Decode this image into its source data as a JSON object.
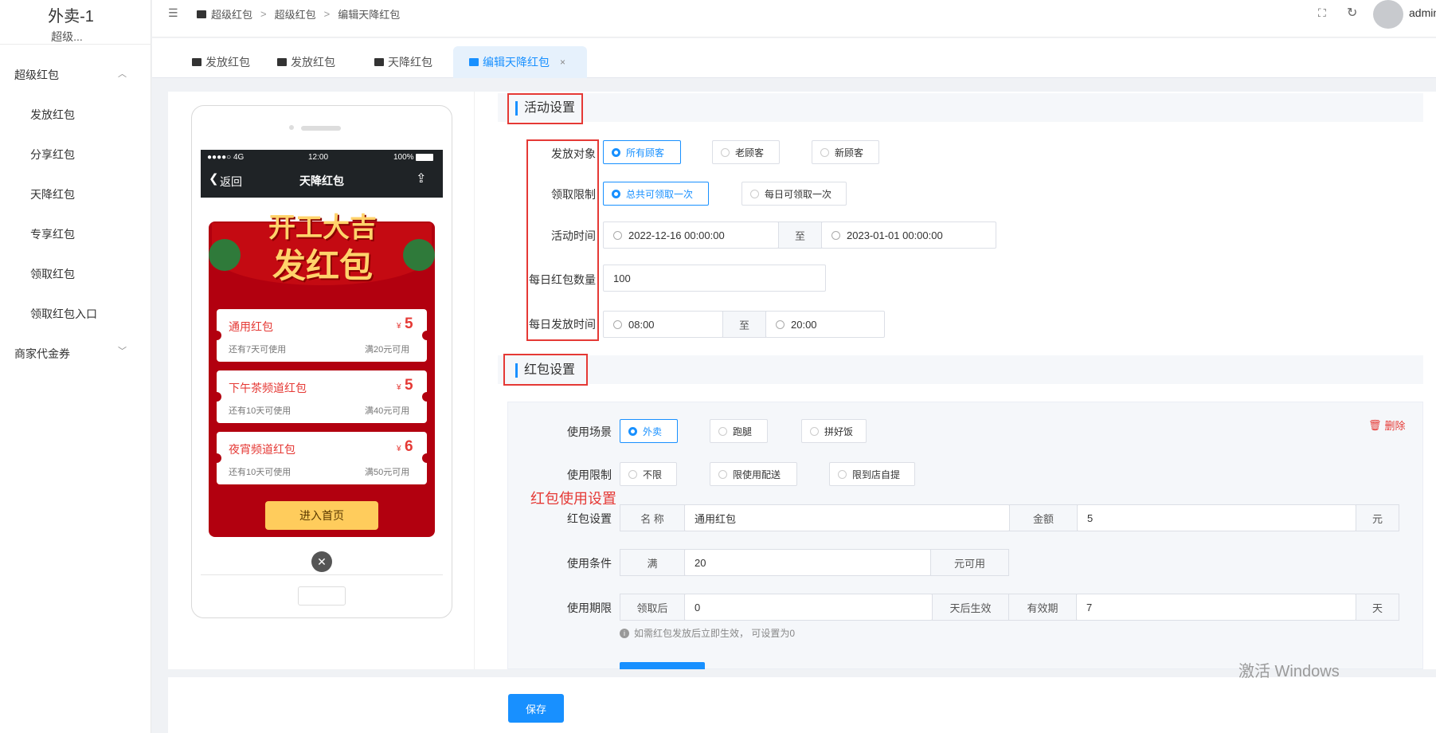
{
  "app": {
    "title": "外卖-1",
    "subtitle": "超级..."
  },
  "sidebar": {
    "groups": [
      {
        "label": "超级红包",
        "items": [
          "发放红包",
          "分享红包",
          "天降红包",
          "专享红包",
          "领取红包",
          "领取红包入口"
        ]
      },
      {
        "label": "商家代金券"
      }
    ]
  },
  "breadcrumb": [
    "超级红包",
    "超级红包",
    "编辑天降红包"
  ],
  "user": {
    "name": "admin"
  },
  "tabs": [
    {
      "label": "发放红包"
    },
    {
      "label": "发放红包"
    },
    {
      "label": "天降红包"
    },
    {
      "label": "编辑天降红包",
      "active": true
    }
  ],
  "phone": {
    "status": {
      "signal": "●●●●○ 4G",
      "time": "12:00",
      "battery": "100%"
    },
    "nav": {
      "back": "返回",
      "title": "天降红包"
    },
    "banner": {
      "line1": "开工大吉",
      "line2": "发红包"
    },
    "coupons": [
      {
        "name": "通用红包",
        "symbol": "¥",
        "amount": "5",
        "validity": "还有7天可使用",
        "cond": "满20元可用"
      },
      {
        "name": "下午茶频道红包",
        "symbol": "¥",
        "amount": "5",
        "validity": "还有10天可使用",
        "cond": "满40元可用"
      },
      {
        "name": "夜宵频道红包",
        "symbol": "¥",
        "amount": "6",
        "validity": "还有10天可使用",
        "cond": "满50元可用"
      }
    ],
    "cta": "进入首页"
  },
  "activity": {
    "title": "活动设置",
    "target": {
      "label": "发放对象",
      "options": [
        "所有顾客",
        "老顾客",
        "新顾客"
      ],
      "selected": 0
    },
    "limit": {
      "label": "领取限制",
      "options": [
        "总共可领取一次",
        "每日可领取一次"
      ],
      "selected": 0
    },
    "time": {
      "label": "活动时间",
      "start": "2022-12-16 00:00:00",
      "sep": "至",
      "end": "2023-01-01 00:00:00"
    },
    "daily_count": {
      "label": "每日红包数量",
      "value": "100"
    },
    "daily_time": {
      "label": "每日发放时间",
      "start": "08:00",
      "sep": "至",
      "end": "20:00"
    }
  },
  "redpack": {
    "title": "红包设置",
    "delete_label": "删除",
    "annotation": "红包使用设置",
    "scene": {
      "label": "使用场景",
      "options": [
        "外卖",
        "跑腿",
        "拼好饭"
      ],
      "selected": 0
    },
    "restrict": {
      "label": "使用限制",
      "options": [
        "不限",
        "限使用配送",
        "限到店自提"
      ],
      "selected": -1
    },
    "setting": {
      "label": "红包设置",
      "name_addon": "名 称",
      "name_value": "通用红包",
      "amount_addon": "金额",
      "amount_value": "5",
      "unit": "元"
    },
    "condition": {
      "label": "使用条件",
      "prefix": "满",
      "value": "20",
      "suffix": "元可用"
    },
    "period": {
      "label": "使用期限",
      "prefix": "领取后",
      "value": "0",
      "mid": "天后生效",
      "valid_addon": "有效期",
      "valid_value": "7",
      "unit": "天"
    },
    "hint": "如需红包发放后立即生效， 可设置为0"
  },
  "save_label": "保存",
  "watermark": "激活 Windows",
  "colors": {
    "primary": "#1890ff",
    "danger": "#e53935",
    "phone_red": "#b2000f",
    "cta": "#ffcc5c"
  }
}
